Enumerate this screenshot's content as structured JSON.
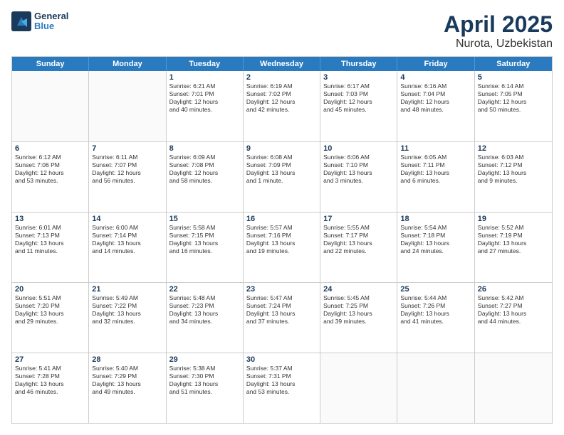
{
  "app": {
    "logo_line1": "General",
    "logo_line2": "Blue"
  },
  "title": {
    "month": "April 2025",
    "location": "Nurota, Uzbekistan"
  },
  "header": {
    "days": [
      "Sunday",
      "Monday",
      "Tuesday",
      "Wednesday",
      "Thursday",
      "Friday",
      "Saturday"
    ]
  },
  "weeks": [
    {
      "cells": [
        {
          "day": "",
          "info": ""
        },
        {
          "day": "",
          "info": ""
        },
        {
          "day": "1",
          "info": "Sunrise: 6:21 AM\nSunset: 7:01 PM\nDaylight: 12 hours\nand 40 minutes."
        },
        {
          "day": "2",
          "info": "Sunrise: 6:19 AM\nSunset: 7:02 PM\nDaylight: 12 hours\nand 42 minutes."
        },
        {
          "day": "3",
          "info": "Sunrise: 6:17 AM\nSunset: 7:03 PM\nDaylight: 12 hours\nand 45 minutes."
        },
        {
          "day": "4",
          "info": "Sunrise: 6:16 AM\nSunset: 7:04 PM\nDaylight: 12 hours\nand 48 minutes."
        },
        {
          "day": "5",
          "info": "Sunrise: 6:14 AM\nSunset: 7:05 PM\nDaylight: 12 hours\nand 50 minutes."
        }
      ]
    },
    {
      "cells": [
        {
          "day": "6",
          "info": "Sunrise: 6:12 AM\nSunset: 7:06 PM\nDaylight: 12 hours\nand 53 minutes."
        },
        {
          "day": "7",
          "info": "Sunrise: 6:11 AM\nSunset: 7:07 PM\nDaylight: 12 hours\nand 56 minutes."
        },
        {
          "day": "8",
          "info": "Sunrise: 6:09 AM\nSunset: 7:08 PM\nDaylight: 12 hours\nand 58 minutes."
        },
        {
          "day": "9",
          "info": "Sunrise: 6:08 AM\nSunset: 7:09 PM\nDaylight: 13 hours\nand 1 minute."
        },
        {
          "day": "10",
          "info": "Sunrise: 6:06 AM\nSunset: 7:10 PM\nDaylight: 13 hours\nand 3 minutes."
        },
        {
          "day": "11",
          "info": "Sunrise: 6:05 AM\nSunset: 7:11 PM\nDaylight: 13 hours\nand 6 minutes."
        },
        {
          "day": "12",
          "info": "Sunrise: 6:03 AM\nSunset: 7:12 PM\nDaylight: 13 hours\nand 9 minutes."
        }
      ]
    },
    {
      "cells": [
        {
          "day": "13",
          "info": "Sunrise: 6:01 AM\nSunset: 7:13 PM\nDaylight: 13 hours\nand 11 minutes."
        },
        {
          "day": "14",
          "info": "Sunrise: 6:00 AM\nSunset: 7:14 PM\nDaylight: 13 hours\nand 14 minutes."
        },
        {
          "day": "15",
          "info": "Sunrise: 5:58 AM\nSunset: 7:15 PM\nDaylight: 13 hours\nand 16 minutes."
        },
        {
          "day": "16",
          "info": "Sunrise: 5:57 AM\nSunset: 7:16 PM\nDaylight: 13 hours\nand 19 minutes."
        },
        {
          "day": "17",
          "info": "Sunrise: 5:55 AM\nSunset: 7:17 PM\nDaylight: 13 hours\nand 22 minutes."
        },
        {
          "day": "18",
          "info": "Sunrise: 5:54 AM\nSunset: 7:18 PM\nDaylight: 13 hours\nand 24 minutes."
        },
        {
          "day": "19",
          "info": "Sunrise: 5:52 AM\nSunset: 7:19 PM\nDaylight: 13 hours\nand 27 minutes."
        }
      ]
    },
    {
      "cells": [
        {
          "day": "20",
          "info": "Sunrise: 5:51 AM\nSunset: 7:20 PM\nDaylight: 13 hours\nand 29 minutes."
        },
        {
          "day": "21",
          "info": "Sunrise: 5:49 AM\nSunset: 7:22 PM\nDaylight: 13 hours\nand 32 minutes."
        },
        {
          "day": "22",
          "info": "Sunrise: 5:48 AM\nSunset: 7:23 PM\nDaylight: 13 hours\nand 34 minutes."
        },
        {
          "day": "23",
          "info": "Sunrise: 5:47 AM\nSunset: 7:24 PM\nDaylight: 13 hours\nand 37 minutes."
        },
        {
          "day": "24",
          "info": "Sunrise: 5:45 AM\nSunset: 7:25 PM\nDaylight: 13 hours\nand 39 minutes."
        },
        {
          "day": "25",
          "info": "Sunrise: 5:44 AM\nSunset: 7:26 PM\nDaylight: 13 hours\nand 41 minutes."
        },
        {
          "day": "26",
          "info": "Sunrise: 5:42 AM\nSunset: 7:27 PM\nDaylight: 13 hours\nand 44 minutes."
        }
      ]
    },
    {
      "cells": [
        {
          "day": "27",
          "info": "Sunrise: 5:41 AM\nSunset: 7:28 PM\nDaylight: 13 hours\nand 46 minutes."
        },
        {
          "day": "28",
          "info": "Sunrise: 5:40 AM\nSunset: 7:29 PM\nDaylight: 13 hours\nand 49 minutes."
        },
        {
          "day": "29",
          "info": "Sunrise: 5:38 AM\nSunset: 7:30 PM\nDaylight: 13 hours\nand 51 minutes."
        },
        {
          "day": "30",
          "info": "Sunrise: 5:37 AM\nSunset: 7:31 PM\nDaylight: 13 hours\nand 53 minutes."
        },
        {
          "day": "",
          "info": ""
        },
        {
          "day": "",
          "info": ""
        },
        {
          "day": "",
          "info": ""
        }
      ]
    }
  ]
}
